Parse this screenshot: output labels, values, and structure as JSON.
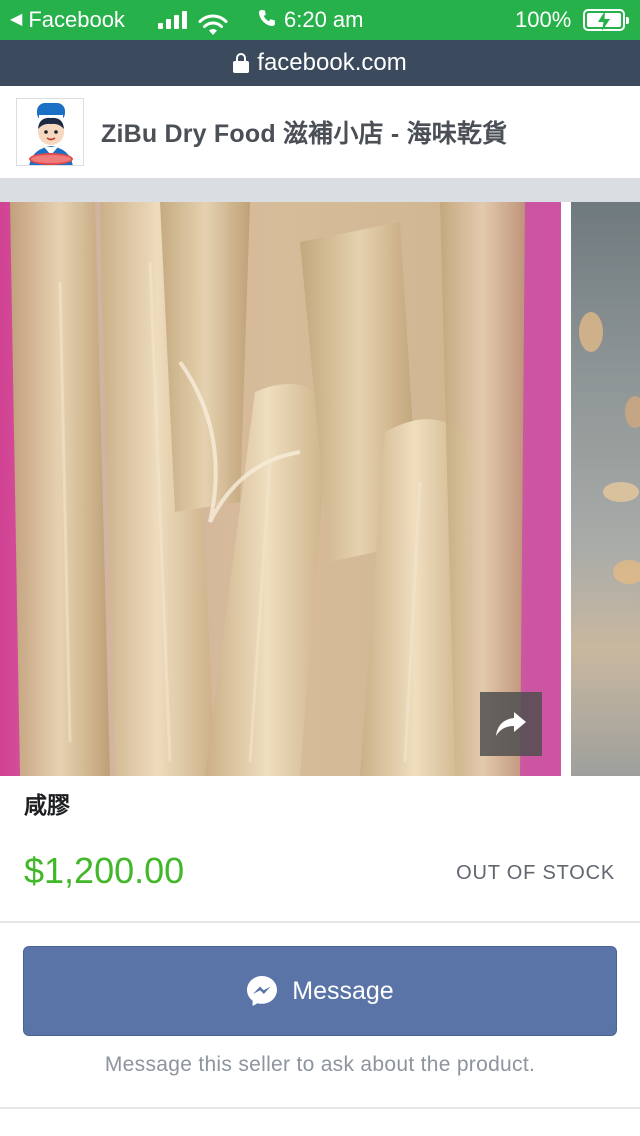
{
  "status_bar": {
    "back_app": "Facebook",
    "time": "6:20 am",
    "battery_percent": "100%",
    "signal_bars": 4,
    "charging": true
  },
  "browser": {
    "url": "facebook.com"
  },
  "page": {
    "name": "ZiBu Dry Food 滋補小店 - 海味乾貨"
  },
  "product": {
    "title": "咸膠",
    "price": "$1,200.00",
    "stock_status": "OUT OF STOCK"
  },
  "actions": {
    "message_label": "Message",
    "message_helper": "Message this seller to ask about the product."
  },
  "icons": {
    "back": "back-arrow-icon",
    "signal": "cellular-signal-icon",
    "wifi": "wifi-icon",
    "call": "phone-icon",
    "battery": "battery-charging-icon",
    "lock": "lock-icon",
    "share": "share-icon",
    "messenger": "messenger-icon"
  },
  "colors": {
    "status_bar": "#27b14b",
    "url_bar": "#3b4a5c",
    "price": "#42b72a",
    "message_button": "#5b74a8",
    "divider_band": "#dadde1"
  }
}
